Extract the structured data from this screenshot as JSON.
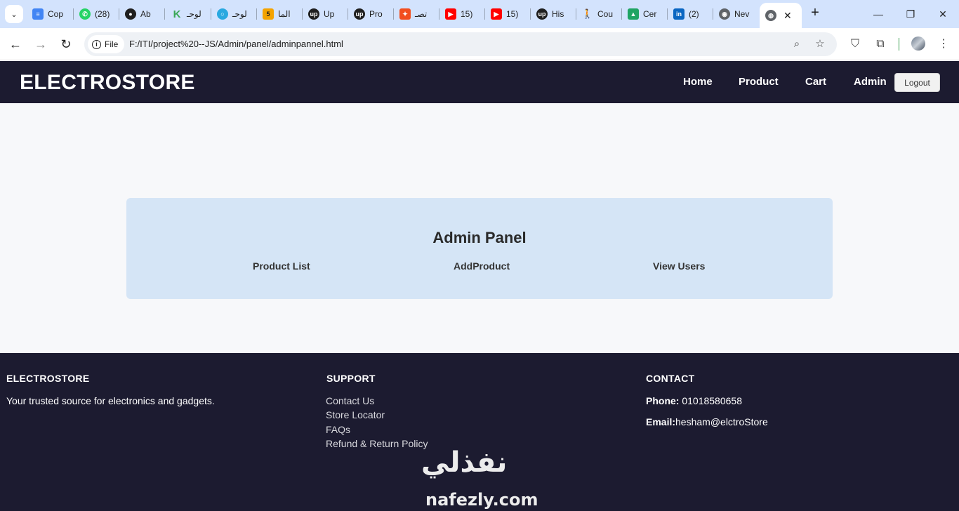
{
  "browser": {
    "tabs": [
      {
        "title": "Cop",
        "icon": "docs-icon",
        "color": "#4285f4"
      },
      {
        "title": "(28)",
        "icon": "whatsapp-icon",
        "color": "#25d366"
      },
      {
        "title": "Ab",
        "icon": "github-icon",
        "color": "#1f1f1f"
      },
      {
        "title": "لوحـ",
        "icon": "k-icon",
        "color": "#3aa757"
      },
      {
        "title": "لوحـ",
        "icon": "circle-icon",
        "color": "#29a8e0"
      },
      {
        "title": "الما",
        "icon": "five-icon",
        "color": "#f4a300"
      },
      {
        "title": "Up",
        "icon": "upwork-icon",
        "color": "#1f1f1f"
      },
      {
        "title": "Pro",
        "icon": "upwork-icon",
        "color": "#1f1f1f"
      },
      {
        "title": "تصـ",
        "icon": "figma-icon",
        "color": "#f24e1e"
      },
      {
        "title": "15)",
        "icon": "youtube-icon",
        "color": "#ff0000"
      },
      {
        "title": "15)",
        "icon": "youtube-icon",
        "color": "#ff0000"
      },
      {
        "title": "His",
        "icon": "upwork-icon",
        "color": "#1f1f1f"
      },
      {
        "title": "Cou",
        "icon": "person-icon",
        "color": "#e8a33d"
      },
      {
        "title": "Cer",
        "icon": "drive-icon",
        "color": "#1fa463"
      },
      {
        "title": "(2)",
        "icon": "linkedin-icon",
        "color": "#0a66c2"
      },
      {
        "title": "Nev",
        "icon": "chrome-icon",
        "color": "#5f6368"
      }
    ],
    "active_tab_icon": "globe-icon",
    "address_chip": "File",
    "url": "F:/ITI/project%20--JS/Admin/panel/adminpannel.html"
  },
  "site": {
    "logo": "ELECTROSTORE",
    "nav": [
      "Home",
      "Product",
      "Cart",
      "Admin"
    ],
    "logout_label": "Logout"
  },
  "panel": {
    "title": "Admin Panel",
    "links": [
      "Product List",
      "AddProduct",
      "View Users"
    ]
  },
  "footer": {
    "brand": {
      "heading": "ELECTROSTORE",
      "text": "Your trusted source for electronics and gadgets."
    },
    "support": {
      "heading": "SUPPORT",
      "links": [
        "Contact Us",
        "Store Locator",
        "FAQs",
        "Refund & Return Policy"
      ]
    },
    "contact": {
      "heading": "CONTACT",
      "phone_label": "Phone:",
      "phone": "01018580658",
      "email_label": "Email:",
      "email": "hesham@elctroStore"
    }
  },
  "watermark": {
    "arabic": "نفذلي",
    "latin": "nafezly.com"
  },
  "colors": {
    "header_bg": "#1c1b30",
    "panel_bg": "#d5e5f6",
    "page_bg": "#f7f8fa",
    "tabstrip_bg": "#d3e3fd"
  }
}
